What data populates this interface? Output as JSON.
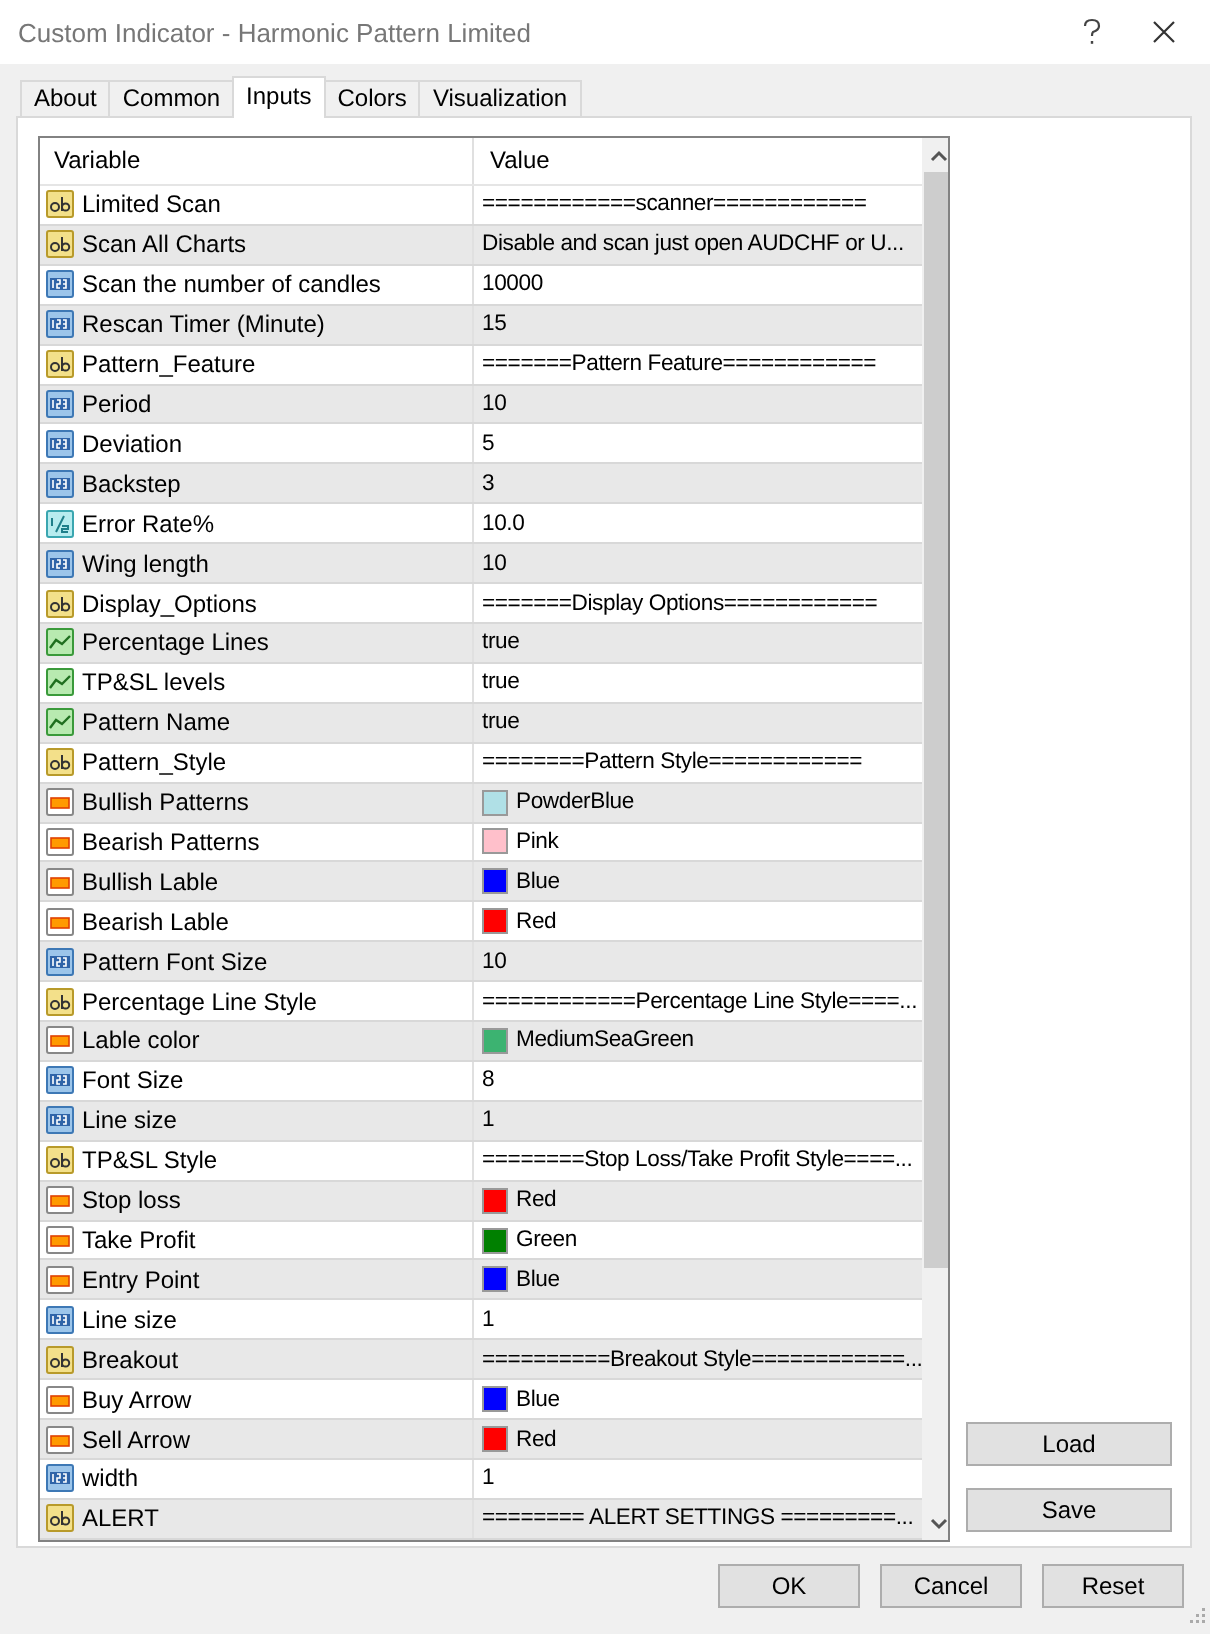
{
  "window": {
    "title": "Custom Indicator - Harmonic Pattern Limited"
  },
  "tabs": [
    {
      "label": "About",
      "selected": false
    },
    {
      "label": "Common",
      "selected": false
    },
    {
      "label": "Inputs",
      "selected": true
    },
    {
      "label": "Colors",
      "selected": false
    },
    {
      "label": "Visualization",
      "selected": false
    }
  ],
  "table": {
    "columns": [
      "Variable",
      "Value"
    ],
    "rows": [
      {
        "kind": "string",
        "variable": "Limited Scan",
        "value": "============scanner============"
      },
      {
        "kind": "string",
        "variable": "Scan All Charts",
        "value": "Disable and scan just open AUDCHF or U..."
      },
      {
        "kind": "integer",
        "variable": "Scan the number of candles",
        "value": "10000"
      },
      {
        "kind": "integer",
        "variable": "Rescan Timer (Minute)",
        "value": "15"
      },
      {
        "kind": "string",
        "variable": "Pattern_Feature",
        "value": "=======Pattern Feature============"
      },
      {
        "kind": "integer",
        "variable": "Period",
        "value": "10"
      },
      {
        "kind": "integer",
        "variable": "Deviation",
        "value": "5"
      },
      {
        "kind": "integer",
        "variable": "Backstep",
        "value": "3"
      },
      {
        "kind": "double",
        "variable": "Error Rate%",
        "value": "10.0"
      },
      {
        "kind": "integer",
        "variable": "Wing length",
        "value": "10"
      },
      {
        "kind": "string",
        "variable": "Display_Options",
        "value": "=======Display Options============"
      },
      {
        "kind": "bool",
        "variable": "Percentage Lines",
        "value": "true"
      },
      {
        "kind": "bool",
        "variable": "TP&SL levels",
        "value": "true"
      },
      {
        "kind": "bool",
        "variable": "Pattern Name",
        "value": "true"
      },
      {
        "kind": "string",
        "variable": "Pattern_Style",
        "value": "========Pattern Style============"
      },
      {
        "kind": "color",
        "variable": "Bullish Patterns",
        "value": "PowderBlue",
        "color": "#b0e0e6"
      },
      {
        "kind": "color",
        "variable": "Bearish Patterns",
        "value": "Pink",
        "color": "#ffc0cb"
      },
      {
        "kind": "color",
        "variable": "Bullish Lable",
        "value": "Blue",
        "color": "#0000ff"
      },
      {
        "kind": "color",
        "variable": "Bearish Lable",
        "value": "Red",
        "color": "#ff0000"
      },
      {
        "kind": "integer",
        "variable": "Pattern Font Size",
        "value": "10"
      },
      {
        "kind": "string",
        "variable": "Percentage Line Style",
        "value": "============Percentage Line Style====..."
      },
      {
        "kind": "color",
        "variable": "Lable color",
        "value": "MediumSeaGreen",
        "color": "#3cb371"
      },
      {
        "kind": "integer",
        "variable": "Font Size",
        "value": "8"
      },
      {
        "kind": "integer",
        "variable": "Line size",
        "value": "1"
      },
      {
        "kind": "string",
        "variable": "TP&SL Style",
        "value": "========Stop Loss/Take Profit Style====..."
      },
      {
        "kind": "color",
        "variable": "Stop loss",
        "value": "Red",
        "color": "#ff0000"
      },
      {
        "kind": "color",
        "variable": "Take Profit",
        "value": "Green",
        "color": "#008000"
      },
      {
        "kind": "color",
        "variable": "Entry Point",
        "value": "Blue",
        "color": "#0000ff"
      },
      {
        "kind": "integer",
        "variable": "Line size",
        "value": "1"
      },
      {
        "kind": "string",
        "variable": "Breakout",
        "value": "==========Breakout Style============..."
      },
      {
        "kind": "color",
        "variable": "Buy Arrow",
        "value": "Blue",
        "color": "#0000ff"
      },
      {
        "kind": "color",
        "variable": "Sell Arrow",
        "value": "Red",
        "color": "#ff0000"
      },
      {
        "kind": "integer",
        "variable": "width",
        "value": "1"
      },
      {
        "kind": "string",
        "variable": "ALERT",
        "value": "======== ALERT SETTINGS =========..."
      }
    ]
  },
  "side_buttons": [
    "Load",
    "Save"
  ],
  "buttons": [
    "OK",
    "Cancel",
    "Reset"
  ]
}
